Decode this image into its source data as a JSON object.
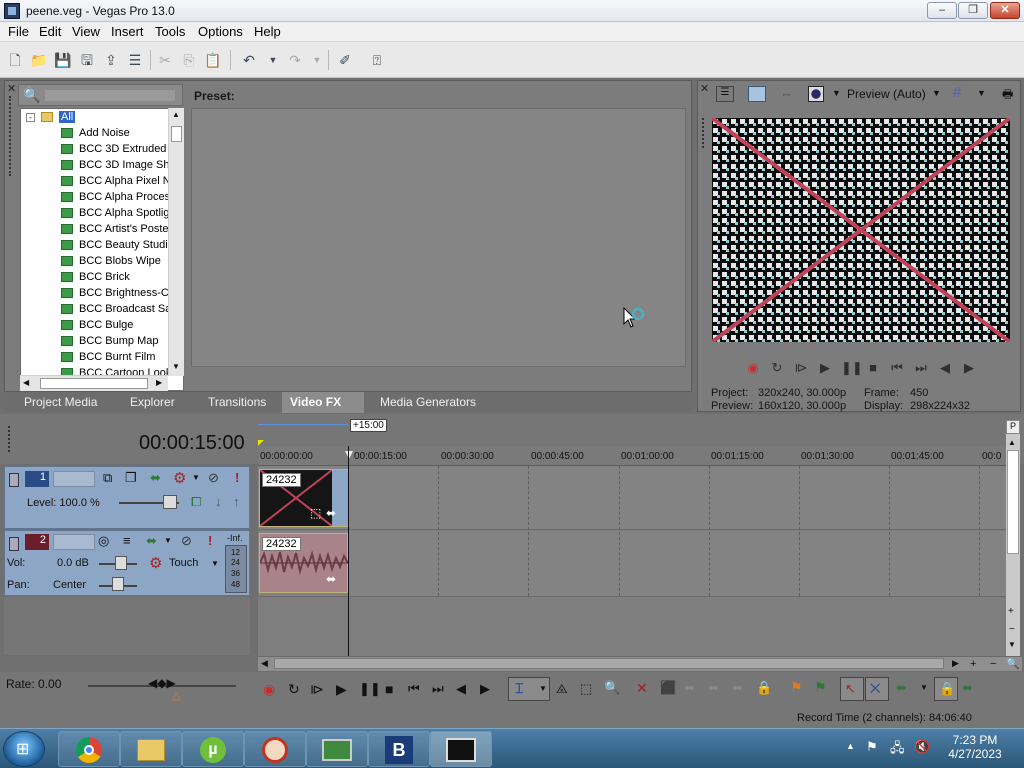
{
  "window": {
    "title": "peene.veg - Vegas Pro 13.0"
  },
  "menu": [
    "File",
    "Edit",
    "View",
    "Insert",
    "Tools",
    "Options",
    "Help"
  ],
  "fx_panel": {
    "search_placeholder": "",
    "preset_label": "Preset:",
    "tree": [
      "All",
      "Add Noise",
      "BCC 3D Extruded",
      "BCC 3D Image Sha",
      "BCC Alpha Pixel N",
      "BCC Alpha Proces",
      "BCC Alpha Spotlig",
      "BCC Artist's Poste",
      "BCC Beauty Studi",
      "BCC Blobs Wipe",
      "BCC Brick",
      "BCC Brightness-C",
      "BCC Broadcast Sa",
      "BCC Bulge",
      "BCC Bump Map",
      "BCC Burnt Film",
      "BCC Cartoon Look"
    ],
    "tabs": [
      "Project Media",
      "Explorer",
      "Transitions",
      "Video FX",
      "Media Generators"
    ],
    "active_tab": "Video FX"
  },
  "preview": {
    "mode_label": "Preview (Auto)",
    "project_label": "Project:",
    "project_value": "320x240, 30.000p",
    "preview_label": "Preview:",
    "preview_value": "160x120, 30.000p",
    "frame_label": "Frame:",
    "frame_value": "450",
    "display_label": "Display:",
    "display_value": "298x224x32"
  },
  "timeline": {
    "timecode": "00:00:15:00",
    "marker_label": "+15:00",
    "ruler_labels": [
      "00:00:00:00",
      "00:00:15:00",
      "00:00:30:00",
      "00:00:45:00",
      "00:01:00:00",
      "00:01:15:00",
      "00:01:30:00",
      "00:01:45:00",
      "00:0"
    ],
    "track1": {
      "number": "1",
      "level_label": "Level: 100.0 %",
      "clip_label": "24232"
    },
    "track2": {
      "number": "2",
      "vol_label": "Vol:",
      "vol_value": "0.0 dB",
      "pan_label": "Pan:",
      "pan_value": "Center",
      "automation": "Touch",
      "meter_top": "-Inf.",
      "meter_ticks": [
        "12",
        "24",
        "36",
        "48"
      ],
      "clip_label": "24232"
    }
  },
  "transport": {
    "rate_label": "Rate: 0.00"
  },
  "status": {
    "record_time": "Record Time (2 channels): 84:06:40"
  },
  "taskbar": {
    "time": "7:23 PM",
    "date": "4/27/2023"
  },
  "colors": {
    "accent_blue": "#8ea6c6",
    "record_red": "#c62f2f",
    "preview_x": "#c1435a"
  }
}
